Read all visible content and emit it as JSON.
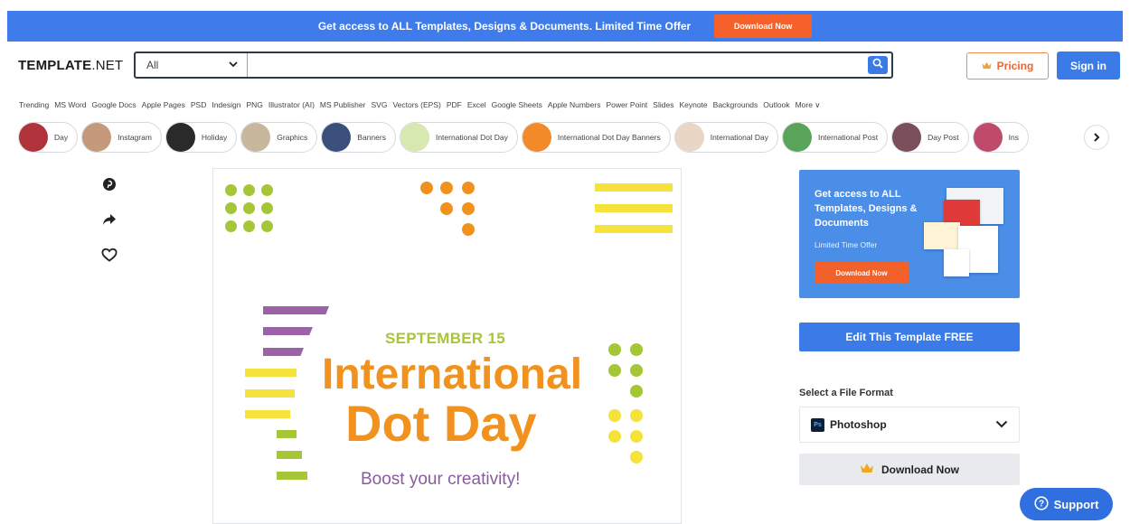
{
  "promo": {
    "text": "Get access to ALL Templates, Designs & Documents. Limited Time Offer",
    "button": "Download Now"
  },
  "header": {
    "logo_main": "TEMPLATE",
    "logo_suffix": ".NET",
    "search_category": "All",
    "search_value": "",
    "pricing_label": "Pricing",
    "signin_label": "Sign in"
  },
  "categories": [
    "Trending",
    "MS Word",
    "Google Docs",
    "Apple Pages",
    "PSD",
    "Indesign",
    "PNG",
    "Illustrator (AI)",
    "MS Publisher",
    "SVG",
    "Vectors (EPS)",
    "PDF",
    "Excel",
    "Google Sheets",
    "Apple Numbers",
    "Power Point",
    "Slides",
    "Keynote",
    "Backgrounds",
    "Outlook",
    "More ∨"
  ],
  "chips": [
    {
      "label": "Day",
      "color": "#b0323a"
    },
    {
      "label": "Instagram",
      "color": "#c49a7a"
    },
    {
      "label": "Holiday",
      "color": "#2a2a2a"
    },
    {
      "label": "Graphics",
      "color": "#c7b79c"
    },
    {
      "label": "Banners",
      "color": "#3a4f7a"
    },
    {
      "label": "International Dot Day",
      "color": "#d7e8b0"
    },
    {
      "label": "International Dot Day Banners",
      "color": "#f28a2a"
    },
    {
      "label": "International Day",
      "color": "#e9d6c4"
    },
    {
      "label": "International Post",
      "color": "#5aa35a"
    },
    {
      "label": "Day Post",
      "color": "#7a4f5a"
    },
    {
      "label": "Ins",
      "color": "#c04a6a"
    }
  ],
  "preview": {
    "date": "SEPTEMBER 15",
    "title_line1": "International",
    "title_line2": "Dot Day",
    "tagline": "Boost your creativity!",
    "colors": {
      "orange": "#f2921e",
      "green": "#a5c636",
      "yellow": "#f5e23a",
      "purple": "#9b62a8"
    }
  },
  "sidebar": {
    "ad_title": "Get access to ALL Templates, Designs & Documents",
    "ad_subtitle": "Limited Time Offer",
    "ad_button": "Download Now",
    "edit_button": "Edit This Template FREE",
    "format_label": "Select a File Format",
    "format_value": "Photoshop",
    "format_badge": "Ps",
    "download_button": "Download Now"
  },
  "support": {
    "label": "Support"
  },
  "accent": "#3a7be8",
  "cta_orange": "#f6612b"
}
